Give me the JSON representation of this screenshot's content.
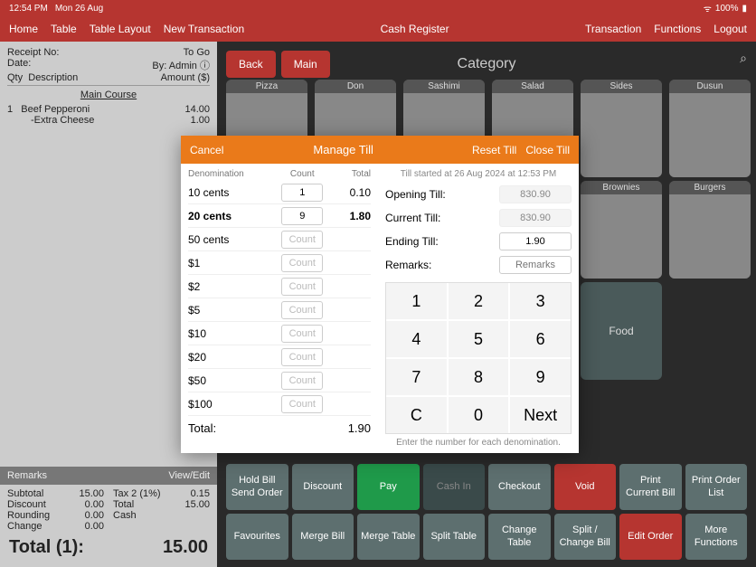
{
  "status": {
    "time": "12:54 PM",
    "date": "Mon 26 Aug",
    "battery": "100%"
  },
  "menu": {
    "left": [
      "Home",
      "Table",
      "Table Layout",
      "New Transaction"
    ],
    "center": "Cash Register",
    "right": [
      "Transaction",
      "Functions",
      "Logout"
    ]
  },
  "receipt": {
    "receipt_no_lbl": "Receipt No:",
    "status": "To Go",
    "date_lbl": "Date:",
    "by": "By: Admin",
    "qty_lbl": "Qty",
    "desc_lbl": "Description",
    "amount_lbl": "Amount ($)",
    "section": "Main Course",
    "line_qty": "1",
    "line_name": "Beef Pepperoni",
    "line_price": "14.00",
    "mod_name": "-Extra Cheese",
    "mod_price": "1.00"
  },
  "remarks_bar": {
    "label": "Remarks",
    "action": "View/Edit"
  },
  "totals": {
    "subtotal_lbl": "Subtotal",
    "subtotal": "15.00",
    "tax_lbl": "Tax 2 (1%)",
    "tax": "0.15",
    "discount_lbl": "Discount",
    "discount": "0.00",
    "total_lbl": "Total",
    "total": "15.00",
    "rounding_lbl": "Rounding",
    "rounding": "0.00",
    "cash_lbl": "Cash",
    "cash": "",
    "change_lbl": "Change",
    "change": "0.00",
    "grand_lbl": "Total (1):",
    "grand": "15.00"
  },
  "top_buttons": {
    "back": "Back",
    "main": "Main"
  },
  "category_header": "Category",
  "categories_r1": [
    "Pizza",
    "Don",
    "Sashimi",
    "Salad",
    "Sides",
    "Dusun"
  ],
  "categories_r2": [
    "Brownies",
    "Burgers"
  ],
  "food_tile": "Food",
  "actions": {
    "r1": [
      "Hold Bill\nSend Order",
      "Discount",
      "Pay",
      "Cash In",
      "Checkout",
      "Void",
      "Print\nCurrent Bill",
      "Print Order\nList"
    ],
    "r2": [
      "Favourites",
      "Merge Bill",
      "Merge Table",
      "Split Table",
      "Change\nTable",
      "Split /\nChange Bill",
      "Edit Order",
      "More\nFunctions"
    ]
  },
  "modal": {
    "cancel": "Cancel",
    "title": "Manage Till",
    "reset": "Reset Till",
    "close": "Close Till",
    "head_denom": "Denomination",
    "head_count": "Count",
    "head_total": "Total",
    "count_ph": "Count",
    "rows": [
      {
        "d": "10 cents",
        "c": "1",
        "t": "0.10"
      },
      {
        "d": "20 cents",
        "c": "9",
        "t": "1.80",
        "bold": true
      },
      {
        "d": "50 cents",
        "c": "",
        "t": ""
      },
      {
        "d": "$1",
        "c": "",
        "t": ""
      },
      {
        "d": "$2",
        "c": "",
        "t": ""
      },
      {
        "d": "$5",
        "c": "",
        "t": ""
      },
      {
        "d": "$10",
        "c": "",
        "t": ""
      },
      {
        "d": "$20",
        "c": "",
        "t": ""
      },
      {
        "d": "$50",
        "c": "",
        "t": ""
      },
      {
        "d": "$100",
        "c": "",
        "t": ""
      }
    ],
    "total_lbl": "Total:",
    "total": "1.90",
    "till_started": "Till started at 26 Aug 2024 at 12:53 PM",
    "opening_lbl": "Opening Till:",
    "opening": "830.90",
    "current_lbl": "Current Till:",
    "current": "830.90",
    "ending_lbl": "Ending Till:",
    "ending": "1.90",
    "remarks_lbl": "Remarks:",
    "remarks_ph": "Remarks",
    "keys": [
      "1",
      "2",
      "3",
      "4",
      "5",
      "6",
      "7",
      "8",
      "9",
      "C",
      "0",
      "Next"
    ],
    "hint": "Enter the number for each denomination."
  }
}
